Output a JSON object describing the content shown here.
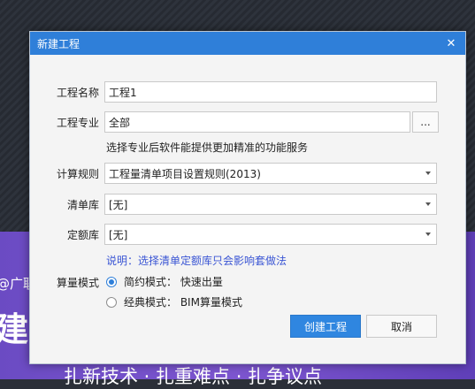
{
  "background": {
    "banner_line1": "@广联",
    "banner_line2": "建",
    "banner_line3": "扎新技术 · 扎重难点 · 扎争议点"
  },
  "dialog": {
    "title": "新建工程",
    "close_icon": "close-icon",
    "fields": {
      "project_name": {
        "label": "工程名称",
        "value": "工程1"
      },
      "profession": {
        "label": "工程专业",
        "value": "全部",
        "browse_label": "..."
      },
      "profession_hint": "选择专业后软件能提供更加精准的功能服务",
      "calc_rule": {
        "label": "计算规则",
        "value": "工程量清单项目设置规则(2013)"
      },
      "bill_library": {
        "label": "清单库",
        "value": "[无]"
      },
      "quota_library": {
        "label": "定额库",
        "value": "[无]"
      },
      "library_note": "说明：选择清单定额库只会影响套做法"
    },
    "mode": {
      "label": "算量模式",
      "options": [
        {
          "label": "简约模式： 快速出量",
          "selected": true
        },
        {
          "label": "经典模式： BIM算量模式",
          "selected": false
        }
      ]
    },
    "buttons": {
      "create": "创建工程",
      "cancel": "取消"
    },
    "colors": {
      "accent": "#2f7fd9",
      "note": "#3a55d4"
    }
  }
}
